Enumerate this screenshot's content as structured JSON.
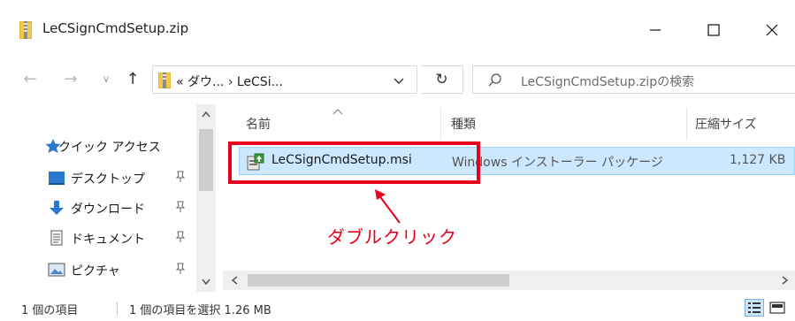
{
  "window": {
    "title": "LeCSignCmdSetup.zip",
    "minimize_glyph": "—",
    "maximize_glyph": "☐",
    "close_glyph": "✕"
  },
  "navigation": {
    "back_glyph": "←",
    "forward_glyph": "→",
    "history_glyph": "∨",
    "up_glyph": "↑"
  },
  "address": {
    "path_text": "« ダウ... › LeCSi...",
    "refresh_glyph": "↻"
  },
  "search": {
    "placeholder": "LeCSignCmdSetup.zipの検索"
  },
  "nav_pane": {
    "quick_access": "クイック アクセス",
    "items": [
      {
        "label": "デスクトップ",
        "icon": "desktop-icon"
      },
      {
        "label": "ダウンロード",
        "icon": "download-icon"
      },
      {
        "label": "ドキュメント",
        "icon": "document-icon"
      },
      {
        "label": "ピクチャ",
        "icon": "picture-icon"
      }
    ]
  },
  "columns": {
    "name": "名前",
    "type": "種類",
    "size": "圧縮サイズ"
  },
  "files": [
    {
      "name": "LeCSignCmdSetup.msi",
      "type": "Windows インストーラー パッケージ",
      "size": "1,127 KB",
      "icon": "msi-installer-icon"
    }
  ],
  "status": {
    "item_count": "1 個の項目",
    "selected": "1 個の項目を選択 1.26 MB"
  },
  "annotation": {
    "text": "ダブルクリック",
    "color": "#e8001c"
  },
  "colors": {
    "selection_bg": "#cce8ff",
    "selection_border": "#99d1ff",
    "annotation_red": "#e8001c"
  }
}
